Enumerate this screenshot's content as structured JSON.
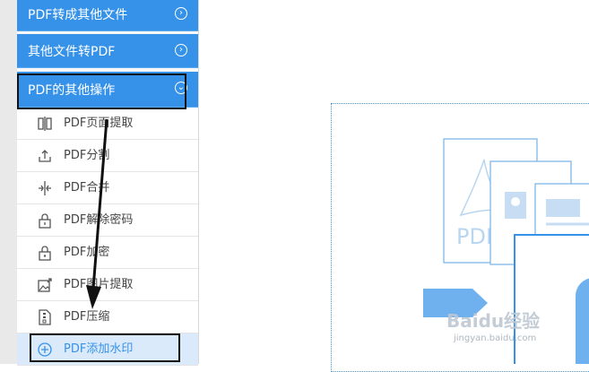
{
  "sidebar": {
    "categories": [
      {
        "label": "PDF转成其他文件",
        "chevron": "›"
      },
      {
        "label": "其他文件转PDF",
        "chevron": "›"
      },
      {
        "label": "PDF的其他操作",
        "chevron": "⌄"
      }
    ],
    "items": [
      {
        "label": "PDF页面提取",
        "icon": "page-extract-icon"
      },
      {
        "label": "PDF分割",
        "icon": "upload-split-icon"
      },
      {
        "label": "PDF合并",
        "icon": "merge-icon"
      },
      {
        "label": "PDF解除密码",
        "icon": "unlock-icon"
      },
      {
        "label": "PDF加密",
        "icon": "lock-icon"
      },
      {
        "label": "PDF图片提取",
        "icon": "image-extract-icon"
      },
      {
        "label": "PDF压缩",
        "icon": "compress-icon"
      },
      {
        "label": "PDF添加水印",
        "icon": "add-circle-icon"
      }
    ]
  },
  "main": {
    "illustration": {
      "doc_label": "PDF"
    }
  },
  "watermark": {
    "brand": "Baidu经验",
    "url": "jingyan.baidu.com"
  },
  "colors": {
    "accent": "#3592e8",
    "active_bg": "#dbeafa",
    "icon_line": "#7fb6e8"
  }
}
